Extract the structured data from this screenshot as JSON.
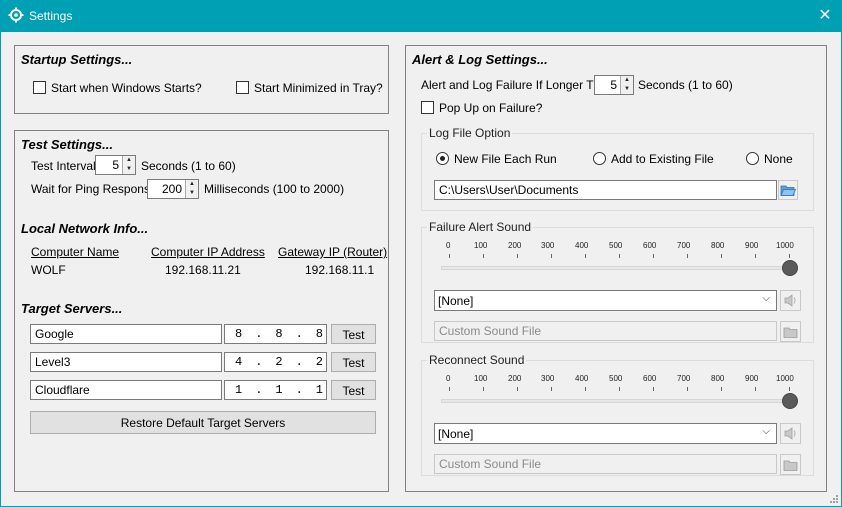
{
  "window": {
    "title": "Settings",
    "close_glyph": "✕",
    "app_icon": "settings-app-icon"
  },
  "startup": {
    "title": "Startup Settings...",
    "start_with_windows": "Start when Windows Starts?",
    "start_minimized": "Start Minimized in Tray?"
  },
  "test": {
    "title": "Test Settings...",
    "interval_label": "Test Interval",
    "interval_value": "5",
    "interval_suffix": "Seconds (1 to 60)",
    "ping_label": "Wait for Ping Response",
    "ping_value": "200",
    "ping_suffix": "Milliseconds (100 to 2000)"
  },
  "network": {
    "title": "Local Network Info...",
    "headers": [
      "Computer Name",
      "Computer IP Address",
      "Gateway IP (Router)"
    ],
    "values": [
      "WOLF",
      "192.168.11.21",
      "192.168.11.1"
    ]
  },
  "targets": {
    "title": "Target Servers...",
    "servers": [
      {
        "name": "Google",
        "ip": "8.8.8.8",
        "button": "Test"
      },
      {
        "name": "Level3",
        "ip": "4.2.2.2",
        "button": "Test"
      },
      {
        "name": "Cloudflare",
        "ip": "1.1.1.1",
        "button": "Test"
      }
    ],
    "restore_button": "Restore Default Target Servers"
  },
  "alert": {
    "title": "Alert & Log Settings...",
    "longer_than_label": "Alert and Log Failure If Longer Than",
    "longer_than_value": "5",
    "longer_than_suffix": "Seconds  (1 to 60)",
    "popup_label": "Pop Up on Failure?",
    "log_option": {
      "label": "Log File Option",
      "options": [
        "New File Each Run",
        "Add to Existing File",
        "None"
      ],
      "selected": "New File Each Run",
      "path": "C:\\Users\\User\\Documents",
      "folder_icon": "folder-open-icon"
    },
    "failure_sound": {
      "label": "Failure Alert Sound",
      "ticks": [
        "0",
        "100",
        "200",
        "300",
        "400",
        "500",
        "600",
        "700",
        "800",
        "900",
        "1000"
      ],
      "slider_value": 1000,
      "sound": "[None]",
      "custom": "Custom Sound File"
    },
    "reconnect_sound": {
      "label": "Reconnect Sound",
      "ticks": [
        "0",
        "100",
        "200",
        "300",
        "400",
        "500",
        "600",
        "700",
        "800",
        "900",
        "1000"
      ],
      "slider_value": 1000,
      "sound": "[None]",
      "custom": "Custom Sound File"
    }
  }
}
